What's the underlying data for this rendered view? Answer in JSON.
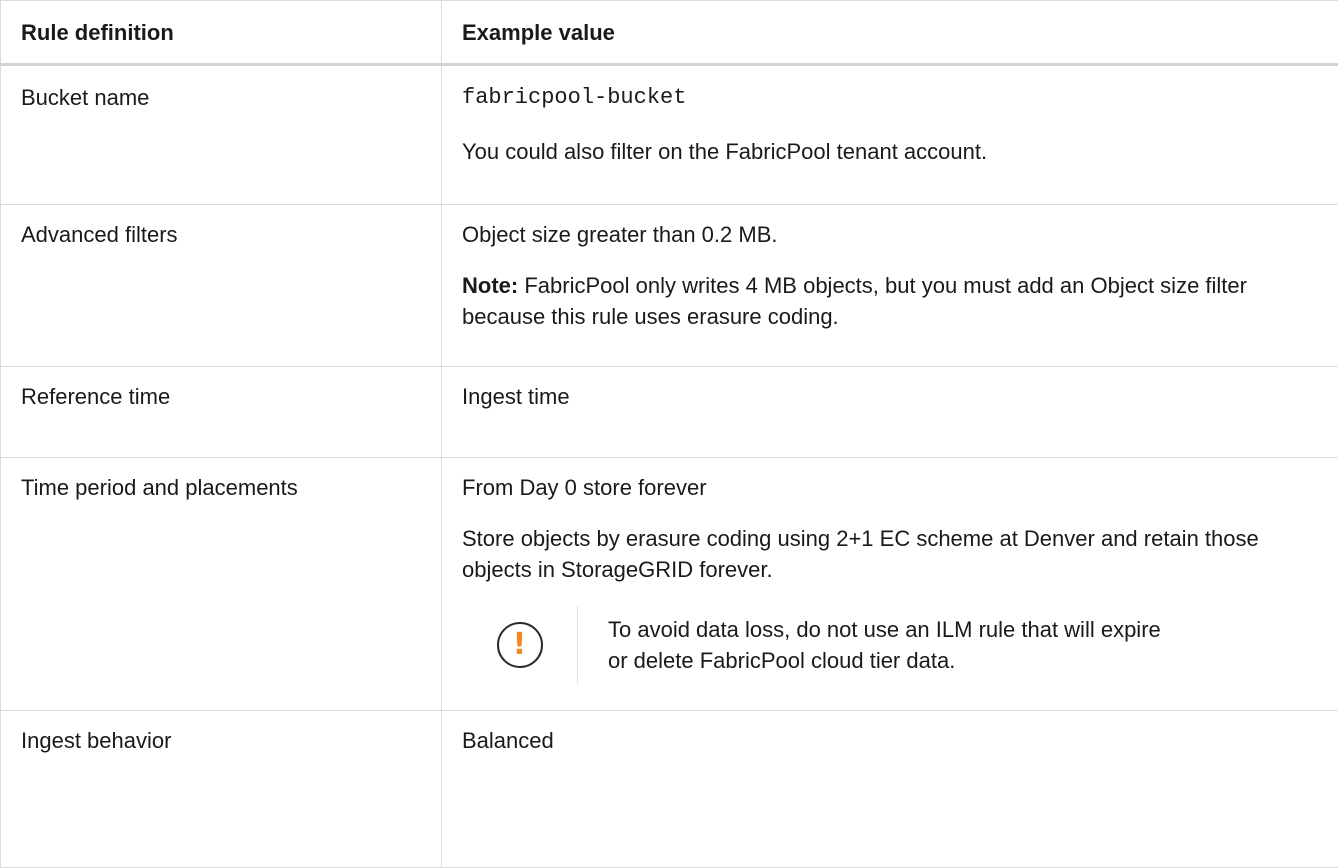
{
  "table": {
    "headers": [
      "Rule definition",
      "Example value"
    ],
    "rows": {
      "bucket": {
        "label": "Bucket name",
        "code": "fabricpool-bucket",
        "text": "You could also filter on the FabricPool tenant account."
      },
      "advanced": {
        "label": "Advanced filters",
        "text": "Object size greater than 0.2 MB.",
        "note_label": "Note:",
        "note_text": " FabricPool only writes 4 MB objects, but you must add an Object size filter because this rule uses erasure coding."
      },
      "reference": {
        "label": "Reference time",
        "text": "Ingest time"
      },
      "time": {
        "label": "Time period and placements",
        "text1": "From Day 0 store forever",
        "text2": "Store objects by erasure coding using 2+1 EC scheme at Denver and retain those objects in StorageGRID forever.",
        "warning_icon": "exclamation-circle-icon",
        "warning_icon_glyph": "!",
        "warning_text": "To avoid data loss, do not use an ILM rule that will expire or delete FabricPool cloud tier data."
      },
      "ingest": {
        "label": "Ingest behavior",
        "text": "Balanced"
      }
    }
  },
  "colors": {
    "warning_accent": "#f08a24",
    "border": "#dcdcdc"
  }
}
